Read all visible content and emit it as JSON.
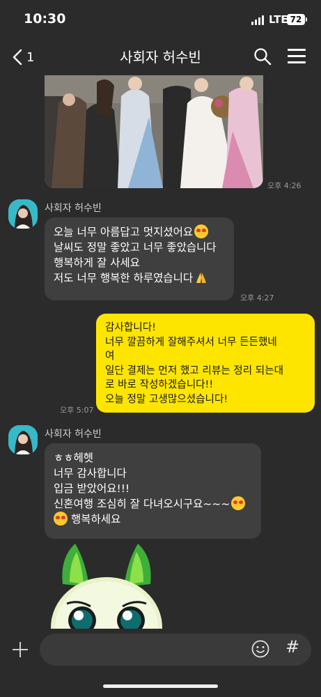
{
  "status_bar": {
    "time": "10:30",
    "network": "LTE",
    "battery": "72"
  },
  "header": {
    "back_count": "1",
    "title": "사회자 허수빈",
    "icons": [
      "chevron-left-icon",
      "search-icon",
      "menu-icon"
    ]
  },
  "messages": [
    {
      "type": "photo",
      "direction": "in",
      "time": "오후 4:26"
    },
    {
      "type": "text",
      "direction": "in",
      "sender": "사회자 허수빈",
      "time": "오후 4:27",
      "lines": [
        "오늘 너무 아름답고 멋지셨어요",
        "날씨도 정말 좋았고 너무 좋았습니다",
        "행복하게 잘 사세요",
        "저도 너무 행복한 하루였습니다"
      ]
    },
    {
      "type": "text",
      "direction": "out",
      "time": "오후 5:07",
      "lines": [
        "감사합니다!",
        "너무 깔끔하게 잘해주셔서 너무 든든했네",
        "여",
        "일단 결제는 먼저 했고 리뷰는 정리 되는대",
        "로 바로 작성하겠습니다!!",
        "오늘 정말 고생많으셨습니다!"
      ]
    },
    {
      "type": "text",
      "direction": "in",
      "sender": "사회자 허수빈",
      "lines": [
        "ㅎㅎ헤헷",
        "너무 감사합니다",
        "입금 받았어요!!!",
        "신혼여행 조심히 잘 다녀오시구요~~~",
        "행복하세요"
      ]
    },
    {
      "type": "sticker",
      "direction": "in"
    }
  ],
  "input": {
    "placeholder": "",
    "value": ""
  },
  "colors": {
    "background": "#2b2b2b",
    "incoming_bubble": "#3f3f3f",
    "outgoing_bubble": "#fee500"
  }
}
